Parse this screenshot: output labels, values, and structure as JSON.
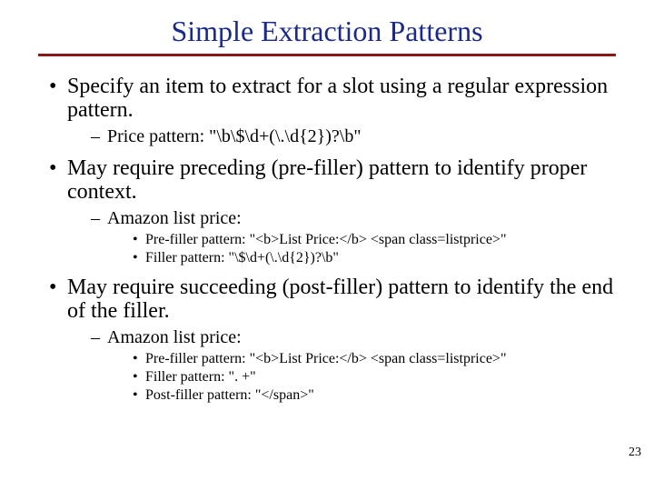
{
  "title": "Simple Extraction Patterns",
  "page_number": "23",
  "bullets": [
    {
      "text": "Specify an item to extract for a slot using a regular expression pattern.",
      "sub": [
        {
          "text": "Price pattern: \"\\b\\$\\d+(\\.\\d{2})?\\b\"",
          "sub": []
        }
      ]
    },
    {
      "text": "May require preceding (pre-filler) pattern to identify proper context.",
      "sub": [
        {
          "text": "Amazon list price:",
          "sub": [
            {
              "text": "Pre-filler pattern: \"<b>List Price:</b> <span class=listprice>\""
            },
            {
              "text": "Filler pattern: \"\\$\\d+(\\.\\d{2})?\\b\""
            }
          ]
        }
      ]
    },
    {
      "text": "May require succeeding (post-filler) pattern to identify the end of the filler.",
      "sub": [
        {
          "text": "Amazon list price:",
          "sub": [
            {
              "text": "Pre-filler pattern: \"<b>List Price:</b> <span class=listprice>\""
            },
            {
              "text": "Filler pattern: \". +\""
            },
            {
              "text": "Post-filler pattern: \"</span>\""
            }
          ]
        }
      ]
    }
  ]
}
